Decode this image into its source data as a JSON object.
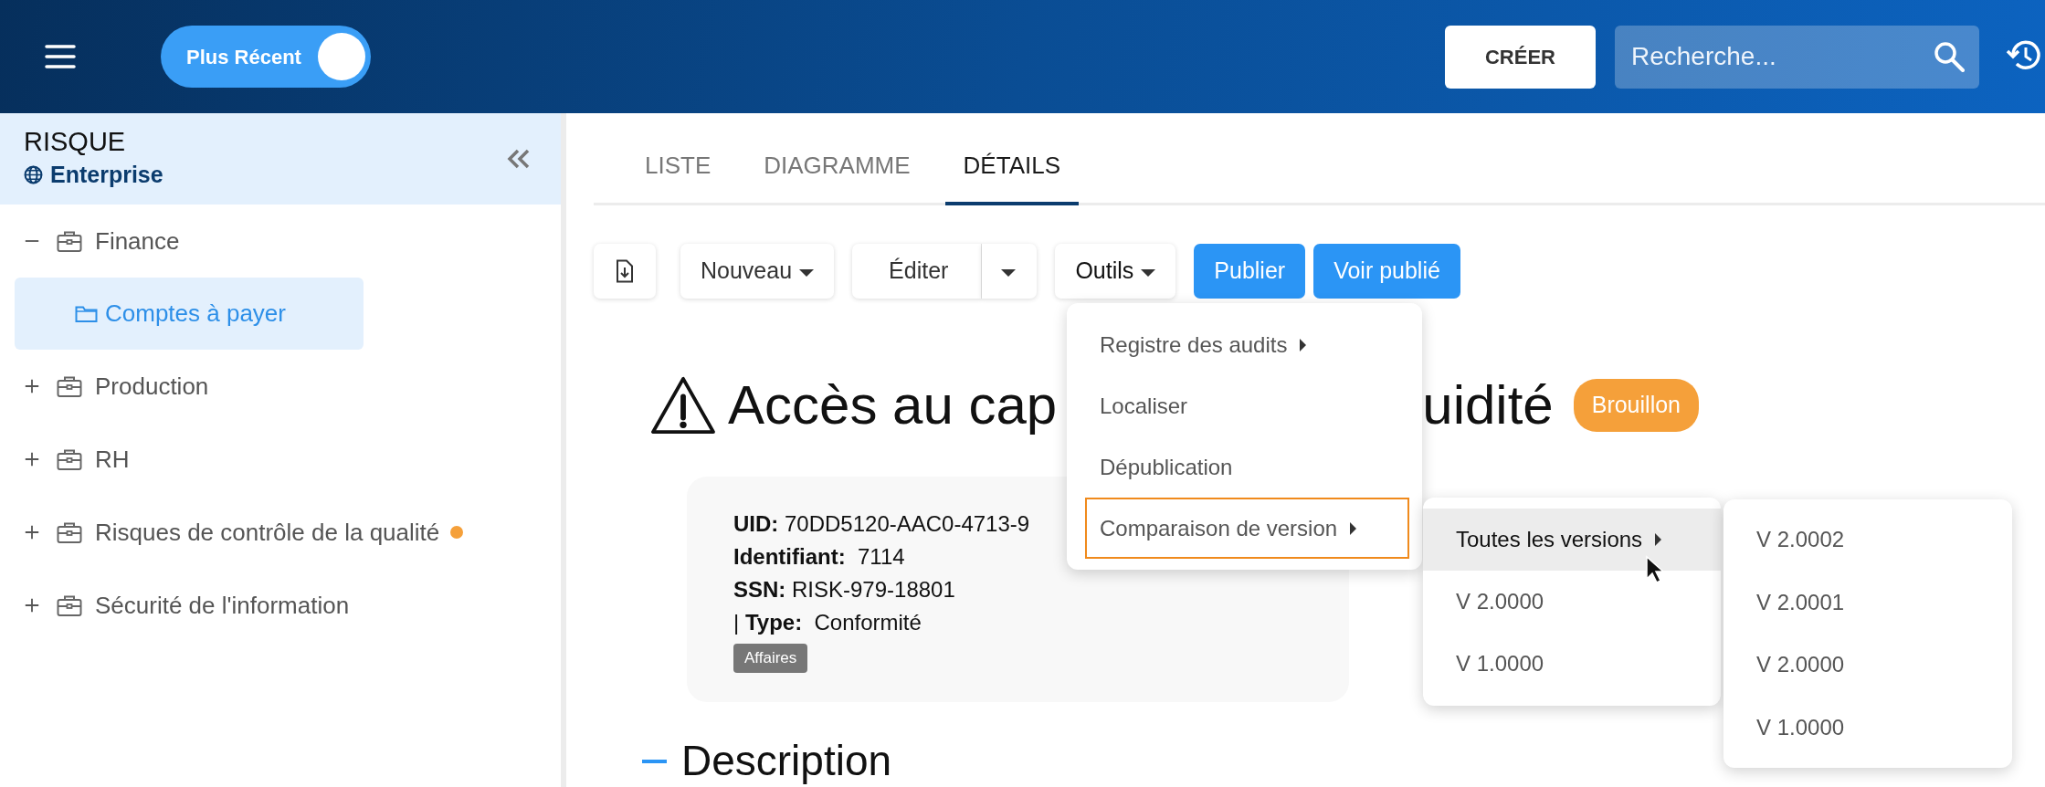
{
  "header": {
    "toggle": {
      "label": "Plus Récent",
      "on": true
    },
    "create_button": "CRÉER",
    "search": {
      "placeholder": "Recherche..."
    }
  },
  "sidebar": {
    "title": "RISQUE",
    "scope": "Enterprise",
    "tree": [
      {
        "label": "Finance",
        "expanded": true,
        "selected": false,
        "children": [
          {
            "label": "Comptes à payer",
            "selected": true
          }
        ]
      },
      {
        "label": "Production",
        "expanded": false,
        "selected": false
      },
      {
        "label": "RH",
        "expanded": false,
        "selected": false
      },
      {
        "label": "Risques de contrôle de la qualité",
        "expanded": false,
        "selected": false,
        "color": "#f5a03a"
      },
      {
        "label": "Sécurité de l'information",
        "expanded": false,
        "selected": false
      }
    ]
  },
  "tabs": [
    {
      "label": "LISTE",
      "selected": false
    },
    {
      "label": "DIAGRAMME",
      "selected": false
    },
    {
      "label": "DÉTAILS",
      "selected": true
    }
  ],
  "toolbar": [
    {
      "kind": "icon"
    },
    {
      "kind": "dropdown",
      "label": "Nouveau"
    },
    {
      "kind": "split",
      "label": "Éditer"
    },
    {
      "kind": "dropdown",
      "label": "Outils",
      "expanded": true
    },
    {
      "kind": "primary",
      "label": "Publier"
    },
    {
      "kind": "primary",
      "label": "Voir publié"
    }
  ],
  "record": {
    "title_start": "Accès au cap",
    "title_end": "uidité",
    "status": "Brouillon",
    "fields": [
      "**UID:** 70DD5120-AAC0-4713-9",
      "**Identifiant:**  7114",
      "**SSN:** RISK-979-18801",
      "| **Type:**  Conformité"
    ],
    "tags": [
      "Affaires"
    ],
    "section": "Description"
  },
  "tools_menu": [
    {
      "label": "Registre des audits",
      "submenu": true,
      "focused": false
    },
    {
      "label": "Localiser",
      "submenu": false,
      "focused": false
    },
    {
      "label": "Dépublication",
      "submenu": false,
      "focused": false
    },
    {
      "label": "Comparaison de version",
      "submenu": true,
      "focused": true
    }
  ],
  "compare_menu": [
    {
      "label": "Toutes les versions",
      "submenu": true,
      "selected": true
    },
    {
      "label": "V 2.0000",
      "submenu": false,
      "selected": false
    },
    {
      "label": "V 1.0000",
      "submenu": false,
      "selected": false
    }
  ],
  "versions_menu": [
    {
      "label": "V 2.0002"
    },
    {
      "label": "V 2.0001"
    },
    {
      "label": "V 2.0000"
    },
    {
      "label": "V 1.0000"
    }
  ]
}
